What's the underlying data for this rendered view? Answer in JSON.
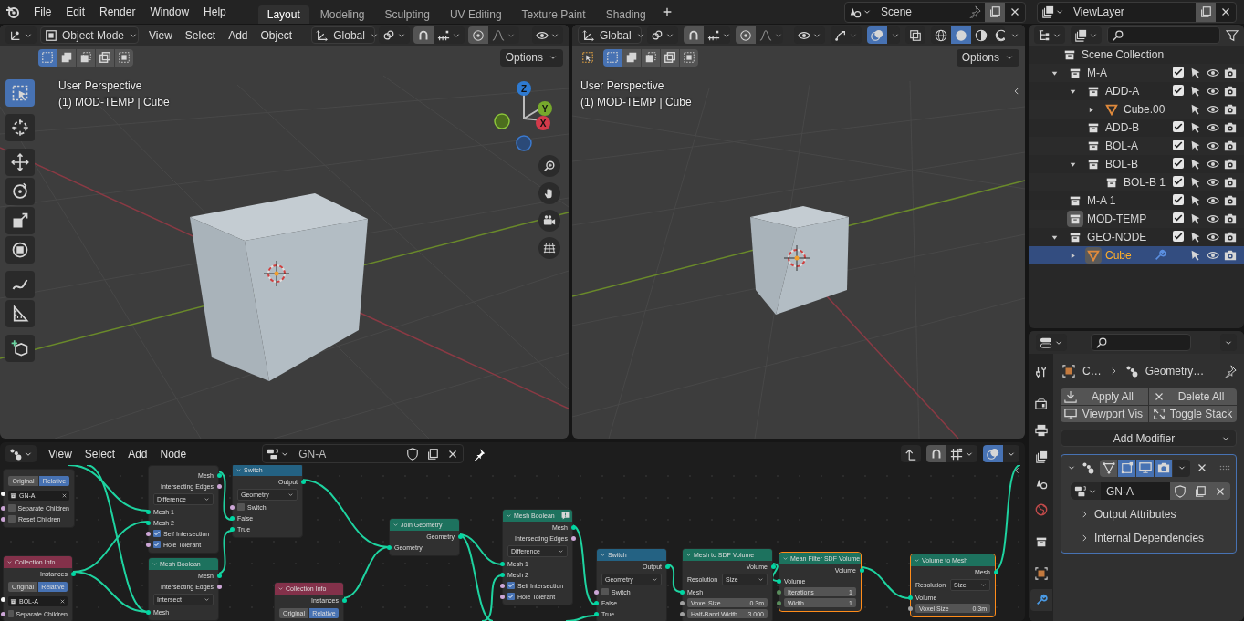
{
  "top_bar": {
    "menus": [
      "File",
      "Edit",
      "Render",
      "Window",
      "Help"
    ],
    "workspaces": [
      {
        "label": "Layout",
        "selected": true
      },
      {
        "label": "Modeling",
        "selected": false
      },
      {
        "label": "Sculpting",
        "selected": false
      },
      {
        "label": "UV Editing",
        "selected": false
      },
      {
        "label": "Texture Paint",
        "selected": false
      },
      {
        "label": "Shading",
        "selected": false
      }
    ],
    "scene": "Scene",
    "view_layer": "ViewLayer"
  },
  "viewport_left": {
    "mode": "Object Mode",
    "menus": [
      "View",
      "Select",
      "Add",
      "Object"
    ],
    "orientation": "Global",
    "options": "Options",
    "select_modes": [
      {
        "selected": true
      },
      {
        "selected": false
      },
      {
        "selected": false
      },
      {
        "selected": false
      },
      {
        "selected": false
      }
    ],
    "overlay_lines": [
      "User Perspective",
      "(1) MOD-TEMP | Cube"
    ],
    "tools": [
      {
        "kind": "select-box",
        "selected": true
      },
      {
        "kind": "cursor",
        "selected": false
      },
      {
        "kind": "move",
        "selected": false
      },
      {
        "kind": "rotate",
        "selected": false
      },
      {
        "kind": "scale",
        "selected": false
      },
      {
        "kind": "transform",
        "selected": false
      },
      {
        "kind": "annotate",
        "selected": false
      },
      {
        "kind": "measure",
        "selected": false
      },
      {
        "kind": "add-cube",
        "selected": false
      }
    ],
    "gizmo_axes": [
      "Z",
      "Y",
      "X"
    ]
  },
  "viewport_right": {
    "orientation": "Global",
    "options": "Options",
    "select_modes": [
      {
        "selected": true
      },
      {
        "selected": false
      },
      {
        "selected": false
      },
      {
        "selected": false
      },
      {
        "selected": false
      }
    ],
    "overlay_lines": [
      "User Perspective",
      "(1) MOD-TEMP | Cube"
    ],
    "shading_modes": [
      {
        "kind": "wireframe",
        "selected": false
      },
      {
        "kind": "solid",
        "selected": true
      },
      {
        "kind": "material",
        "selected": false
      },
      {
        "kind": "rendered",
        "selected": false
      }
    ]
  },
  "outliner": {
    "root": "Scene Collection",
    "items": [
      {
        "name": "M-A",
        "kind": "collection",
        "expanded": true,
        "checked": true,
        "selected": false,
        "active": false,
        "children": [
          {
            "name": "ADD-A",
            "kind": "collection",
            "expanded": true,
            "checked": true,
            "selected": false,
            "active": false,
            "children": [
              {
                "name": "Cube.00",
                "kind": "mesh",
                "expanded": false,
                "selected": false,
                "active": false
              }
            ]
          },
          {
            "name": "ADD-B",
            "kind": "collection",
            "checked": true,
            "selected": false,
            "active": false
          },
          {
            "name": "BOL-A",
            "kind": "collection",
            "checked": true,
            "selected": false,
            "active": false
          },
          {
            "name": "BOL-B",
            "kind": "collection",
            "expanded": true,
            "checked": true,
            "selected": false,
            "active": false,
            "children": [
              {
                "name": "BOL-B 1",
                "kind": "collection",
                "checked": true,
                "selected": false,
                "active": false
              }
            ]
          }
        ]
      },
      {
        "name": "M-A 1",
        "kind": "collection",
        "checked": true,
        "selected": false,
        "active": false
      },
      {
        "name": "MOD-TEMP",
        "kind": "collection",
        "checked": true,
        "selected": false,
        "active": true
      },
      {
        "name": "GEO-NODE",
        "kind": "collection",
        "expanded": true,
        "checked": true,
        "selected": false,
        "active": false,
        "children": [
          {
            "name": "Cube",
            "kind": "mesh",
            "expanded": false,
            "modifier": true,
            "selected": true,
            "active": true
          }
        ]
      }
    ]
  },
  "properties": {
    "tabs": [
      {
        "kind": "tool",
        "selected": false
      },
      {
        "kind": "render",
        "selected": false
      },
      {
        "kind": "output",
        "selected": false
      },
      {
        "kind": "view-layer",
        "selected": false
      },
      {
        "kind": "scene",
        "selected": false
      },
      {
        "kind": "world",
        "selected": false
      },
      {
        "kind": "collection",
        "selected": false
      },
      {
        "kind": "object",
        "selected": false
      },
      {
        "kind": "modifiers",
        "selected": true
      }
    ],
    "breadcrumb": [
      "C…",
      "Geometry…"
    ],
    "buttons": [
      "Apply All",
      "Delete All",
      "Viewport Vis",
      "Toggle Stack"
    ],
    "add_modifier": "Add Modifier",
    "modifier": {
      "expanded": true,
      "toggles": [
        {
          "kind": "edit-cage",
          "on": false
        },
        {
          "kind": "edit-mode",
          "on": true
        },
        {
          "kind": "viewport",
          "on": true
        },
        {
          "kind": "render",
          "on": true
        }
      ],
      "node_group": "GN-A",
      "panels": [
        {
          "label": "Output Attributes",
          "expanded": false
        },
        {
          "label": "Internal Dependencies",
          "expanded": false
        }
      ]
    }
  },
  "node_editor": {
    "menus": [
      "View",
      "Select",
      "Add",
      "Node"
    ],
    "node_group": "GN-A",
    "nodes": [
      {
        "selected": false,
        "rows": [
          {
            "kind": "toggle",
            "options": [
              {
                "label": "Original",
                "selected": false
              },
              {
                "label": "Relative",
                "selected": true
              }
            ]
          },
          {
            "kind": "field",
            "value": "GN-A",
            "color": "#f5f5f5"
          },
          {
            "kind": "checkbox",
            "label": "Separate Children",
            "checked": false,
            "color": "#cca6d6"
          },
          {
            "kind": "checkbox",
            "label": "Reset Children",
            "checked": false,
            "color": "#cca6d6"
          }
        ]
      },
      {
        "selected": false,
        "rows": [
          {
            "kind": "output",
            "label": "Mesh",
            "color": "#00d6a3"
          },
          {
            "kind": "output",
            "label": "Intersecting Edges",
            "color": "#cca6d6"
          },
          {
            "kind": "dropdown",
            "value": "Difference"
          },
          {
            "kind": "input",
            "label": "Mesh 1",
            "color": "#00d6a3"
          },
          {
            "kind": "input",
            "label": "Mesh 2",
            "color": "#00d6a3"
          },
          {
            "kind": "checkbox",
            "label": "Self Intersection",
            "checked": true,
            "color": "#cca6d6"
          },
          {
            "kind": "checkbox",
            "label": "Hole Tolerant",
            "checked": true,
            "color": "#cca6d6"
          }
        ]
      },
      {
        "color": "#246283",
        "title": "Switch",
        "selected": false,
        "rows": [
          {
            "kind": "output",
            "label": "Output",
            "color": "#00d6a3"
          },
          {
            "kind": "dropdown",
            "value": "Geometry"
          },
          {
            "kind": "checkbox",
            "label": "Switch",
            "checked": false,
            "color": "#cca6d6"
          },
          {
            "kind": "input",
            "label": "False",
            "color": "#00d6a3"
          },
          {
            "kind": "input",
            "label": "True",
            "color": "#00d6a3"
          }
        ]
      },
      {
        "color": "#83314a",
        "title": "Collection Info",
        "selected": false,
        "rows": [
          {
            "kind": "output",
            "label": "Instances",
            "color": "#00d6a3"
          },
          {
            "kind": "toggle",
            "options": [
              {
                "label": "Original",
                "selected": false
              },
              {
                "label": "Relative",
                "selected": true
              }
            ]
          },
          {
            "kind": "field",
            "value": "BOL-A",
            "color": "#f5f5f5"
          },
          {
            "kind": "checkbox",
            "label": "Separate Children",
            "checked": false,
            "color": "#cca6d6"
          }
        ]
      },
      {
        "color": "#1d725e",
        "title": "Mesh Boolean",
        "selected": false,
        "rows": [
          {
            "kind": "output",
            "label": "Mesh",
            "color": "#00d6a3"
          },
          {
            "kind": "output",
            "label": "Intersecting Edges",
            "color": "#cca6d6"
          },
          {
            "kind": "dropdown",
            "value": "Intersect"
          },
          {
            "kind": "input",
            "label": "Mesh",
            "color": "#00d6a3"
          }
        ]
      },
      {
        "color": "#1d725e",
        "title": "Join Geometry",
        "selected": false,
        "rows": [
          {
            "kind": "output",
            "label": "Geometry",
            "color": "#00d6a3"
          },
          {
            "kind": "input",
            "label": "Geometry",
            "color": "#00d6a3"
          }
        ]
      },
      {
        "color": "#83314a",
        "title": "Collection Info",
        "selected": false,
        "rows": [
          {
            "kind": "output",
            "label": "Instances",
            "color": "#00d6a3"
          },
          {
            "kind": "toggle",
            "options": [
              {
                "label": "Original",
                "selected": false
              },
              {
                "label": "Relative",
                "selected": true
              }
            ]
          }
        ]
      },
      {
        "color": "#1d725e",
        "title": "Mesh Boolean",
        "warning": true,
        "selected": false,
        "rows": [
          {
            "kind": "output",
            "label": "Mesh",
            "color": "#00d6a3"
          },
          {
            "kind": "output",
            "label": "Intersecting Edges",
            "color": "#cca6d6"
          },
          {
            "kind": "dropdown",
            "value": "Difference"
          },
          {
            "kind": "input",
            "label": "Mesh 1",
            "color": "#00d6a3"
          },
          {
            "kind": "input",
            "label": "Mesh 2",
            "color": "#00d6a3"
          },
          {
            "kind": "checkbox",
            "label": "Self Intersection",
            "checked": true,
            "color": "#cca6d6"
          },
          {
            "kind": "checkbox",
            "label": "Hole Tolerant",
            "checked": true,
            "color": "#cca6d6"
          }
        ]
      },
      {
        "color": "#246283",
        "title": "Switch",
        "selected": false,
        "rows": [
          {
            "kind": "output",
            "label": "Output",
            "color": "#00d6a3"
          },
          {
            "kind": "dropdown",
            "value": "Geometry"
          },
          {
            "kind": "checkbox",
            "label": "Switch",
            "checked": false,
            "color": "#cca6d6"
          },
          {
            "kind": "input",
            "label": "False",
            "color": "#00d6a3"
          },
          {
            "kind": "input",
            "label": "True",
            "color": "#00d6a3"
          }
        ]
      },
      {
        "color": "#1d725e",
        "title": "Mesh to SDF Volume",
        "selected": false,
        "rows": [
          {
            "kind": "output",
            "label": "Volume",
            "color": "#00d6a3"
          },
          {
            "kind": "dropdown",
            "label": "Resolution",
            "value": "Size"
          },
          {
            "kind": "input",
            "label": "Mesh",
            "color": "#00d6a3"
          },
          {
            "kind": "value",
            "label": "Voxel Size",
            "value": "0.3m",
            "color": "#a1a1a1"
          },
          {
            "kind": "value",
            "label": "Half-Band Width",
            "value": "3.000",
            "color": "#a1a1a1"
          }
        ]
      },
      {
        "color": "#1d725e",
        "title": "Mean Filter SDF Volume",
        "selected": true,
        "rows": [
          {
            "kind": "output",
            "label": "Volume",
            "color": "#00d6a3"
          },
          {
            "kind": "input",
            "label": "Volume",
            "color": "#00d6a3"
          },
          {
            "kind": "value",
            "label": "Iterations",
            "value": "1",
            "color": "#598c5c"
          },
          {
            "kind": "value",
            "label": "Width",
            "value": "1",
            "color": "#598c5c"
          }
        ]
      },
      {
        "color": "#1d725e",
        "title": "Volume to Mesh",
        "selected": true,
        "rows": [
          {
            "kind": "output",
            "label": "Mesh",
            "color": "#00d6a3"
          },
          {
            "kind": "dropdown",
            "label": "Resolution",
            "value": "Size"
          },
          {
            "kind": "input",
            "label": "Volume",
            "color": "#00d6a3"
          },
          {
            "kind": "value",
            "label": "Voxel Size",
            "value": "0.3m",
            "color": "#a1a1a1"
          }
        ]
      }
    ]
  }
}
